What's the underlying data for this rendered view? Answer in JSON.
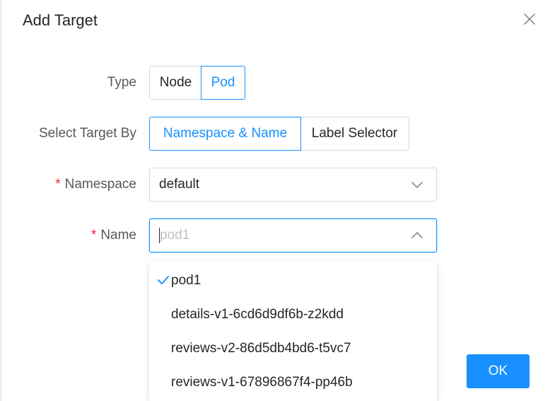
{
  "dialog": {
    "title": "Add Target",
    "ok_label": "OK"
  },
  "form": {
    "type": {
      "label": "Type",
      "options": [
        "Node",
        "Pod"
      ],
      "selected": "Pod"
    },
    "select_by": {
      "label": "Select Target By",
      "options": [
        "Namespace & Name",
        "Label Selector"
      ],
      "selected": "Namespace & Name"
    },
    "namespace": {
      "required_mark": "*",
      "label": "Namespace",
      "value": "default"
    },
    "name": {
      "required_mark": "*",
      "label": "Name",
      "placeholder": "pod1",
      "options": [
        "pod1",
        "details-v1-6cd6d9df6b-z2kdd",
        "reviews-v2-86d5db4bd6-t5vc7",
        "reviews-v1-67896867f4-pp46b"
      ],
      "selected": "pod1"
    }
  },
  "colors": {
    "accent": "#1890ff",
    "required": "#f5222d",
    "border": "#d9d9d9"
  },
  "icons": {
    "close": "close-icon",
    "dropdown": "chevron-down-icon",
    "dropdown_open": "chevron-up-icon",
    "selected_option": "check-icon"
  }
}
